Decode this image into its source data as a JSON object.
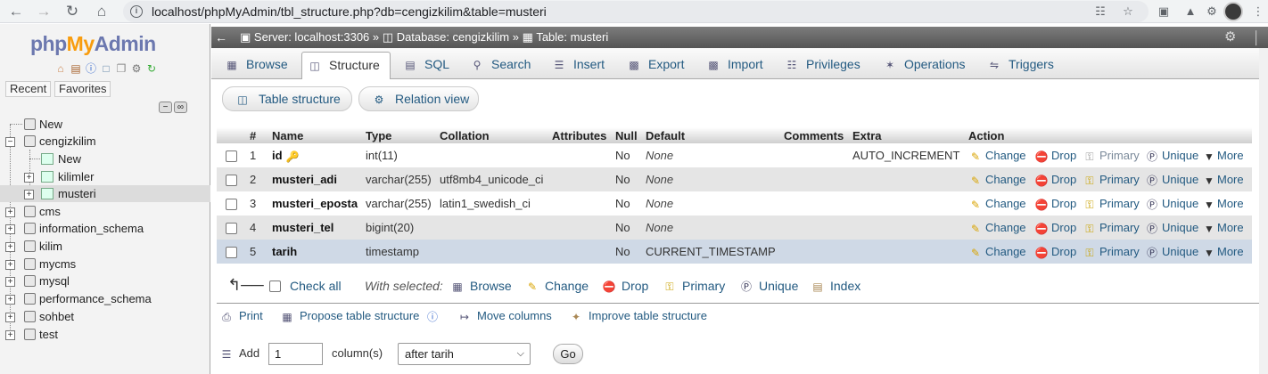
{
  "browser": {
    "url": "localhost/phpMyAdmin/tbl_structure.php?db=cengizkilim&table=musteri"
  },
  "sidebar": {
    "logo": {
      "php": "php",
      "my": "My",
      "admin": "Admin"
    },
    "tabs": {
      "recent": "Recent",
      "favorites": "Favorites"
    },
    "tree": [
      {
        "label": "New"
      },
      {
        "label": "cengizkilim"
      },
      {
        "label": "New"
      },
      {
        "label": "kilimler"
      },
      {
        "label": "musteri"
      },
      {
        "label": "cms"
      },
      {
        "label": "information_schema"
      },
      {
        "label": "kilim"
      },
      {
        "label": "mycms"
      },
      {
        "label": "mysql"
      },
      {
        "label": "performance_schema"
      },
      {
        "label": "sohbet"
      },
      {
        "label": "test"
      }
    ]
  },
  "topbar": {
    "server": "Server: localhost:3306",
    "database": "Database: cengizkilim",
    "table": "Table: musteri",
    "sep": "»"
  },
  "tabs": [
    "Browse",
    "Structure",
    "SQL",
    "Search",
    "Insert",
    "Export",
    "Import",
    "Privileges",
    "Operations",
    "Triggers"
  ],
  "subtabs": {
    "table_structure": "Table structure",
    "relation_view": "Relation view"
  },
  "table": {
    "headers": {
      "num": "#",
      "name": "Name",
      "type": "Type",
      "collation": "Collation",
      "attributes": "Attributes",
      "null": "Null",
      "default": "Default",
      "comments": "Comments",
      "extra": "Extra",
      "action": "Action"
    },
    "rows": [
      {
        "num": "1",
        "name": "id",
        "type": "int(11)",
        "collation": "",
        "null": "No",
        "default": "None",
        "extra": "AUTO_INCREMENT"
      },
      {
        "num": "2",
        "name": "musteri_adi",
        "type": "varchar(255)",
        "collation": "utf8mb4_unicode_ci",
        "null": "No",
        "default": "None",
        "extra": ""
      },
      {
        "num": "3",
        "name": "musteri_eposta",
        "type": "varchar(255)",
        "collation": "latin1_swedish_ci",
        "null": "No",
        "default": "None",
        "extra": ""
      },
      {
        "num": "4",
        "name": "musteri_tel",
        "type": "bigint(20)",
        "collation": "",
        "null": "No",
        "default": "None",
        "extra": ""
      },
      {
        "num": "5",
        "name": "tarih",
        "type": "timestamp",
        "collation": "",
        "null": "No",
        "default": "CURRENT_TIMESTAMP",
        "extra": ""
      }
    ],
    "actions": {
      "change": "Change",
      "drop": "Drop",
      "primary": "Primary",
      "unique": "Unique",
      "more": "More"
    }
  },
  "selection": {
    "check_all": "Check all",
    "with_selected": "With selected:",
    "browse": "Browse",
    "change": "Change",
    "drop": "Drop",
    "primary": "Primary",
    "unique": "Unique",
    "index": "Index"
  },
  "tools": {
    "print": "Print",
    "propose": "Propose table structure",
    "move": "Move columns",
    "improve": "Improve table structure"
  },
  "add": {
    "label": "Add",
    "count": "1",
    "unit": "column(s)",
    "position": "after tarih",
    "go": "Go"
  }
}
